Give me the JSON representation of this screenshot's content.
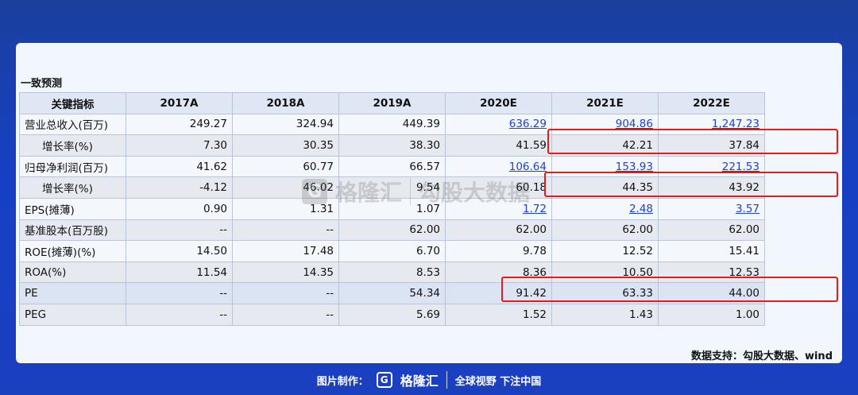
{
  "section_title": "一致预测",
  "table": {
    "headers": [
      "关键指标",
      "2017A",
      "2018A",
      "2019A",
      "2020E",
      "2021E",
      "2022E"
    ],
    "rows": [
      {
        "label": "营业总收入(百万)",
        "indent": false,
        "style": "plain",
        "values": [
          "249.27",
          "324.94",
          "449.39",
          "636.29",
          "904.86",
          "1,247.23"
        ],
        "links": [
          false,
          false,
          false,
          true,
          true,
          true
        ]
      },
      {
        "label": "增长率(%)",
        "indent": true,
        "style": "alt",
        "values": [
          "7.30",
          "30.35",
          "38.30",
          "41.59",
          "42.21",
          "37.84"
        ],
        "links": [
          false,
          false,
          false,
          false,
          false,
          false
        ]
      },
      {
        "label": "归母净利润(百万)",
        "indent": false,
        "style": "plain",
        "values": [
          "41.62",
          "60.77",
          "66.57",
          "106.64",
          "153.93",
          "221.53"
        ],
        "links": [
          false,
          false,
          false,
          true,
          true,
          true
        ]
      },
      {
        "label": "增长率(%)",
        "indent": true,
        "style": "alt",
        "values": [
          "-4.12",
          "46.02",
          "9.54",
          "60.18",
          "44.35",
          "43.92"
        ],
        "links": [
          false,
          false,
          false,
          false,
          false,
          false
        ]
      },
      {
        "label": "EPS(摊薄)",
        "indent": false,
        "style": "plain",
        "values": [
          "0.90",
          "1.31",
          "1.07",
          "1.72",
          "2.48",
          "3.57"
        ],
        "links": [
          false,
          false,
          false,
          true,
          true,
          true
        ]
      },
      {
        "label": "基准股本(百万股)",
        "indent": false,
        "style": "alt",
        "values": [
          "--",
          "--",
          "62.00",
          "62.00",
          "62.00",
          "62.00"
        ],
        "links": [
          false,
          false,
          false,
          false,
          false,
          false
        ]
      },
      {
        "label": "ROE(摊薄)(%)",
        "indent": false,
        "style": "plain",
        "values": [
          "14.50",
          "17.48",
          "6.70",
          "9.78",
          "12.52",
          "15.41"
        ],
        "links": [
          false,
          false,
          false,
          false,
          false,
          false
        ]
      },
      {
        "label": "ROA(%)",
        "indent": false,
        "style": "alt",
        "values": [
          "11.54",
          "14.35",
          "8.53",
          "8.36",
          "10.50",
          "12.53"
        ],
        "links": [
          false,
          false,
          false,
          false,
          false,
          false
        ]
      },
      {
        "label": "PE",
        "indent": false,
        "style": "pe",
        "values": [
          "--",
          "--",
          "54.34",
          "91.42",
          "63.33",
          "44.00"
        ],
        "links": [
          false,
          false,
          false,
          false,
          false,
          false
        ]
      },
      {
        "label": "PEG",
        "indent": false,
        "style": "alt",
        "values": [
          "--",
          "--",
          "5.69",
          "1.52",
          "1.43",
          "1.00"
        ],
        "links": [
          false,
          false,
          false,
          false,
          false,
          false
        ]
      }
    ]
  },
  "watermark": {
    "logo": "G",
    "brand": "格隆汇",
    "product": "勾股大数据"
  },
  "source_note": "数据支持：勾股大数据、wind",
  "footer": {
    "made_by": "图片制作：",
    "logo": "G",
    "brand": "格隆汇",
    "slogan": "全球视野 下注中国"
  },
  "colors": {
    "background": "#1640c4",
    "highlight": "#e01c1c",
    "link": "#1f3fd6"
  }
}
